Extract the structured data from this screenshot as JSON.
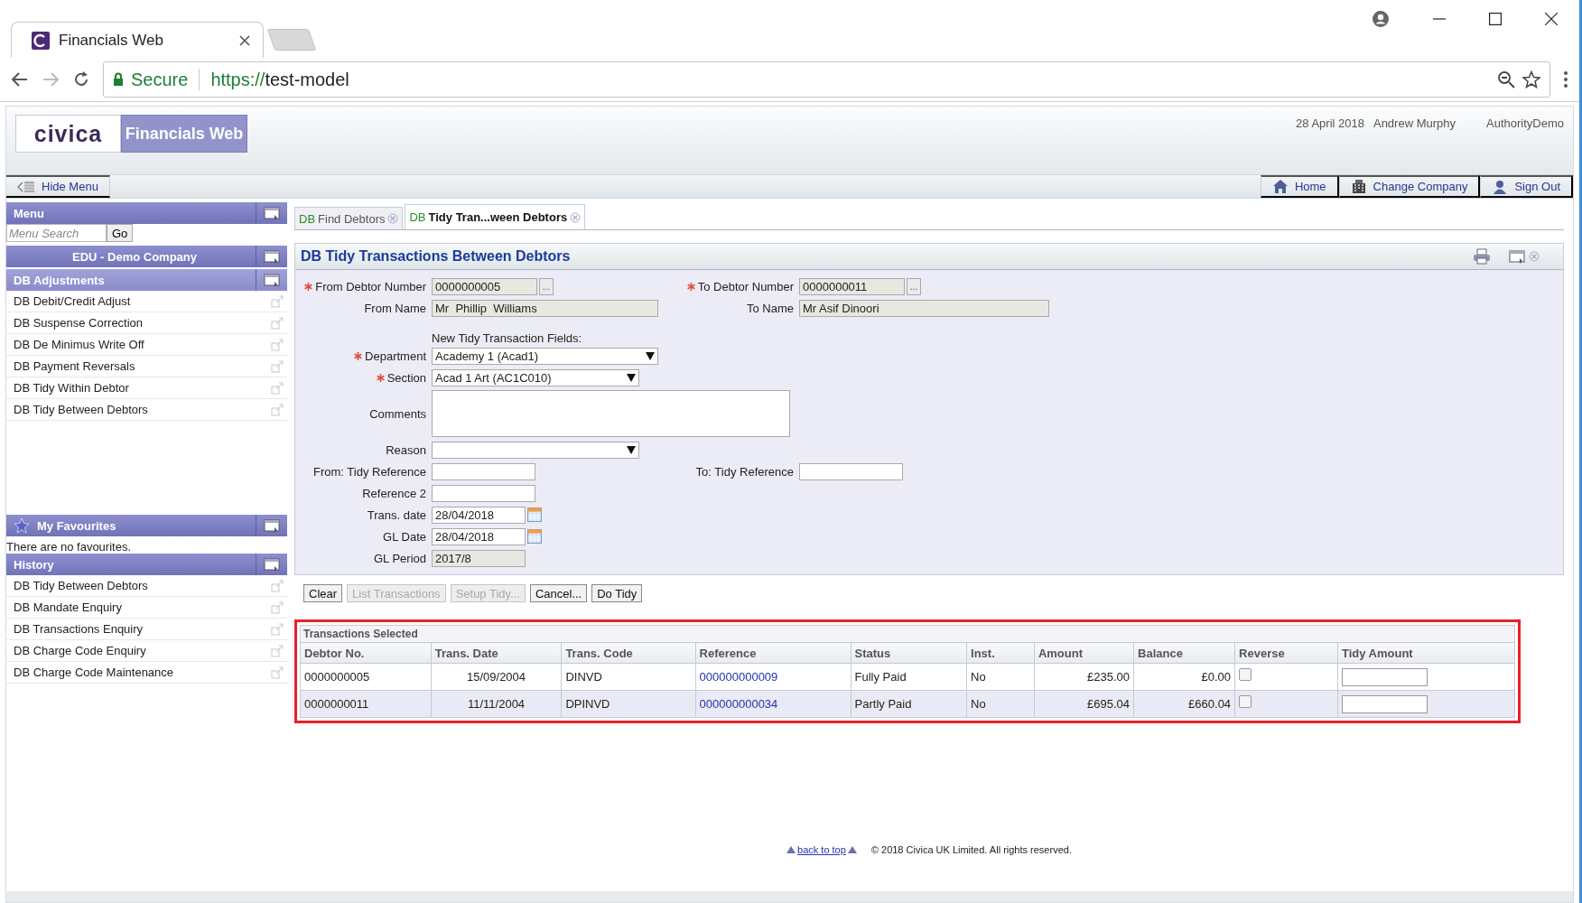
{
  "browser": {
    "tab_title": "Financials Web",
    "secure_label": "Secure",
    "url_scheme": "https://",
    "url_host": "test-model"
  },
  "header": {
    "logo": "civica",
    "app_name": "Financials Web",
    "date": "28 April 2018",
    "user": "Andrew Murphy",
    "authority": "AuthorityDemo"
  },
  "toolbar": {
    "hide_menu": "Hide Menu",
    "links": [
      {
        "kind": "home",
        "label": "Home"
      },
      {
        "kind": "company",
        "label": "Change Company"
      },
      {
        "kind": "signout",
        "label": "Sign Out"
      }
    ]
  },
  "sidebar": {
    "menu_title": "Menu",
    "search_placeholder": "Menu Search",
    "go": "Go",
    "company": "EDU - Demo Company",
    "group": "DB Adjustments",
    "items": [
      "DB Debit/Credit Adjust",
      "DB Suspense Correction",
      "DB De Minimus Write Off",
      "DB Payment Reversals",
      "DB Tidy Within Debtor",
      "DB Tidy Between Debtors"
    ],
    "favourites_title": "My Favourites",
    "favourites_empty": "There are no favourites.",
    "history_title": "History",
    "history": [
      "DB Tidy Between Debtors",
      "DB Mandate Enquiry",
      "DB Transactions Enquiry",
      "DB Charge Code Enquiry",
      "DB Charge Code Maintenance"
    ]
  },
  "tabs": [
    {
      "prefix": "DB",
      "label": "Find Debtors",
      "selected": false
    },
    {
      "prefix": "DB",
      "label": "Tidy Tran...ween Debtors",
      "selected": true
    }
  ],
  "form": {
    "title": "DB Tidy Transactions Between Debtors",
    "rows": [
      {
        "left": {
          "label": "From Debtor Number",
          "required": true,
          "kind": "lookup",
          "value": "0000000005",
          "lookup_label": "..."
        },
        "right": {
          "label": "To Debtor Number",
          "required": true,
          "kind": "lookup",
          "value": "0000000011",
          "lookup_label": "..."
        }
      },
      {
        "left": {
          "label": "From Name",
          "required": false,
          "kind": "readonly",
          "value": "Mr  Phillip  Williams"
        },
        "right": {
          "label": "To Name",
          "required": false,
          "kind": "readonly",
          "value": "Mr Asif Dinoori"
        }
      },
      {
        "left": {
          "kind": "note",
          "value": "New Tidy Transaction Fields:"
        }
      },
      {
        "left": {
          "label": "Department",
          "required": true,
          "kind": "select",
          "value": "Academy 1 (Acad1)"
        }
      },
      {
        "left": {
          "label": "Section",
          "required": true,
          "kind": "select",
          "value": "Acad 1 Art (AC1C010)"
        }
      },
      {
        "left": {
          "label": "Comments",
          "required": false,
          "kind": "textarea"
        }
      },
      {
        "left": {
          "label": "Reason",
          "required": false,
          "kind": "select"
        }
      },
      {
        "left": {
          "label": "From: Tidy Reference",
          "required": false,
          "kind": "text"
        },
        "right": {
          "label": "To: Tidy Reference",
          "required": false,
          "kind": "text"
        }
      },
      {
        "left": {
          "label": "Reference 2",
          "required": false,
          "kind": "text"
        }
      },
      {
        "left": {
          "label": "Trans. date",
          "required": false,
          "kind": "date",
          "value": "28/04/2018"
        }
      },
      {
        "left": {
          "label": "GL Date",
          "required": false,
          "kind": "date",
          "value": "28/04/2018"
        }
      },
      {
        "left": {
          "label": "GL Period",
          "required": false,
          "kind": "readonly",
          "value": "2017/8"
        }
      }
    ]
  },
  "buttons": [
    {
      "label": "Clear",
      "disabled": false
    },
    {
      "label": "List Transactions",
      "disabled": true
    },
    {
      "label": "Setup Tidy...",
      "disabled": true
    },
    {
      "label": "Cancel...",
      "disabled": false
    },
    {
      "label": "Do Tidy",
      "disabled": false
    }
  ],
  "transactions": {
    "title": "Transactions Selected",
    "highlighted": true,
    "columns": [
      {
        "label": "Debtor No.",
        "kind": "text"
      },
      {
        "label": "Trans. Date",
        "kind": "date"
      },
      {
        "label": "Trans. Code",
        "kind": "text"
      },
      {
        "label": "Reference",
        "kind": "link"
      },
      {
        "label": "Status",
        "kind": "text"
      },
      {
        "label": "Inst.",
        "kind": "text"
      },
      {
        "label": "Amount",
        "kind": "money"
      },
      {
        "label": "Balance",
        "kind": "money"
      },
      {
        "label": "Reverse",
        "kind": "check"
      },
      {
        "label": "Tidy Amount",
        "kind": "input"
      }
    ],
    "rows": [
      {
        "cells": [
          "0000000005",
          "15/09/2004",
          "DINVD",
          "000000000009",
          "Fully Paid",
          "No",
          "£235.00",
          "£0.00"
        ],
        "reverse": false
      },
      {
        "cells": [
          "0000000011",
          "11/11/2004",
          "DPINVD",
          "000000000034",
          "Partly Paid",
          "No",
          "£695.04",
          "£660.04"
        ],
        "reverse": false
      }
    ]
  },
  "footer": {
    "back_to_top": "back to top",
    "copyright": "© 2018 Civica UK Limited. All rights reserved."
  }
}
